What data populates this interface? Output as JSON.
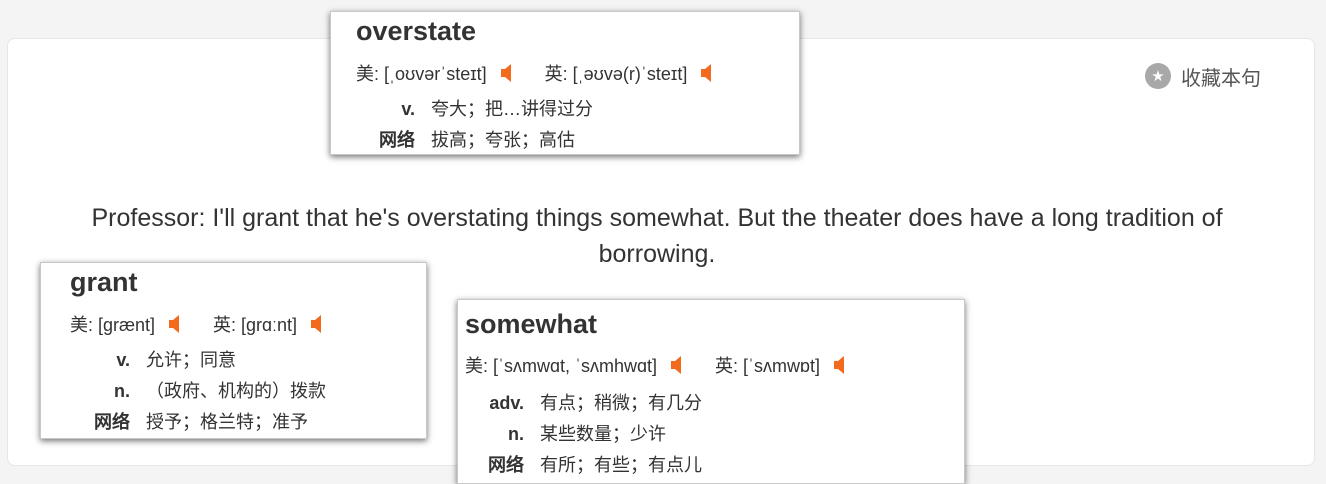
{
  "favorite": {
    "label": "收藏本句",
    "icon": "star-icon"
  },
  "sentence": "Professor: I'll grant that he's overstating things somewhat. But the theater does have a long tradition of borrowing.",
  "popups": {
    "overstate": {
      "word": "overstate",
      "us": "美: [ˌoʊvərˈsteɪt]",
      "uk": "英: [ˌəʊvə(r)ˈsteɪt]",
      "defs": [
        {
          "pos": "v.",
          "meaning": "夸大；把…讲得过分"
        },
        {
          "pos": "网络",
          "meaning": "拔高；夸张；高估"
        }
      ]
    },
    "grant": {
      "word": "grant",
      "us": "美: [grænt]",
      "uk": "英: [grɑːnt]",
      "defs": [
        {
          "pos": "v.",
          "meaning": "允许；同意"
        },
        {
          "pos": "n.",
          "meaning": "（政府、机构的）拨款"
        },
        {
          "pos": "网络",
          "meaning": "授予；格兰特；准予"
        }
      ]
    },
    "somewhat": {
      "word": "somewhat",
      "us": "美: [ˈsʌmwɑt, ˈsʌmhwɑt]",
      "uk": "英: [ˈsʌmwɒt]",
      "defs": [
        {
          "pos": "adv.",
          "meaning": "有点；稍微；有几分"
        },
        {
          "pos": "n.",
          "meaning": "某些数量；少许"
        },
        {
          "pos": "网络",
          "meaning": "有所；有些；有点儿"
        }
      ]
    }
  },
  "colors": {
    "speaker": "#f26b1d",
    "star_bg": "#a8a8a8"
  }
}
